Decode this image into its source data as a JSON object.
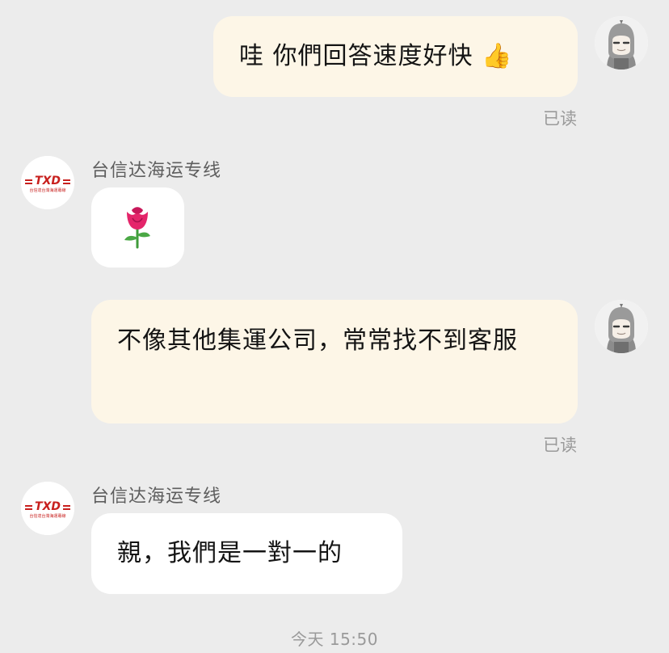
{
  "conversation": {
    "messages": [
      {
        "text": "哇 你們回答速度好快 👍",
        "status": "已读"
      },
      {
        "sender": "台信达海运专线",
        "text": "🌹"
      },
      {
        "text": "不像其他集運公司，常常找不到客服",
        "status": "已读"
      },
      {
        "sender": "台信达海运专线",
        "text": "親，我們是一對一的"
      }
    ],
    "timestamp": "今天 15:50"
  },
  "contact_avatar": {
    "logo_text": "TXD",
    "logo_subtext": "台信達台灣海運專線",
    "brand_color": "#c8201e"
  }
}
